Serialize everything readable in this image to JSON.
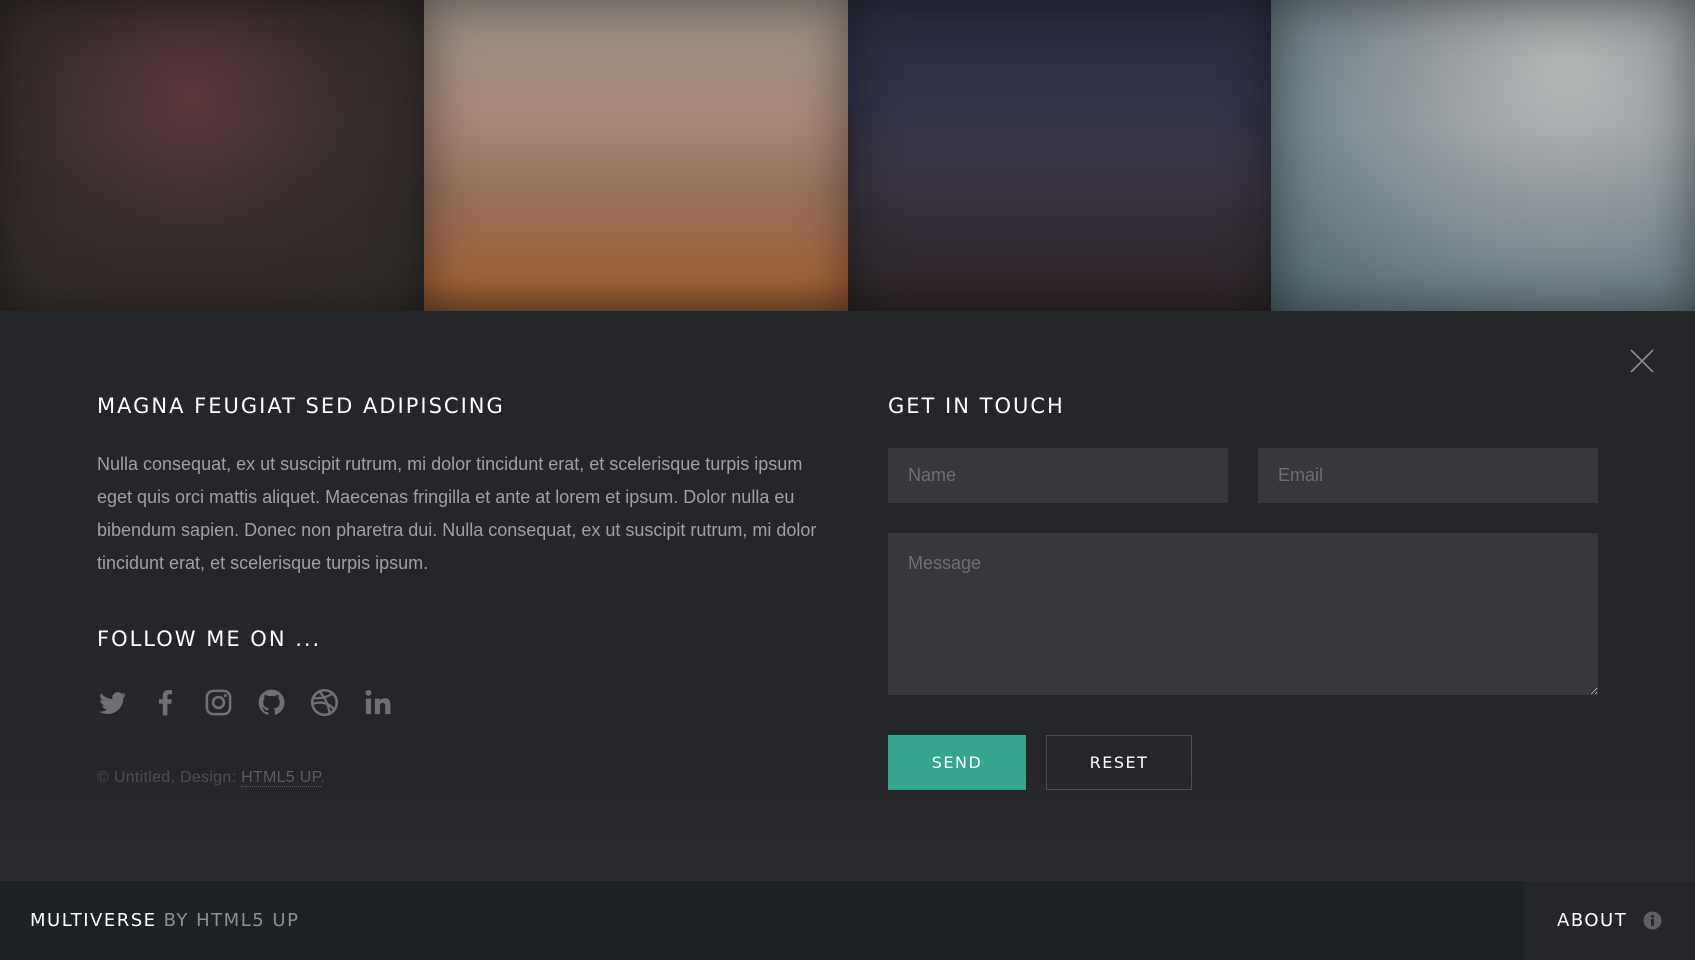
{
  "gallery": {
    "thumbnails": [
      "thumb-1",
      "thumb-2",
      "thumb-3",
      "thumb-4"
    ]
  },
  "panel": {
    "close_icon": "close-icon",
    "about": {
      "heading": "MAGNA FEUGIAT SED ADIPISCING",
      "text": "Nulla consequat, ex ut suscipit rutrum, mi dolor tincidunt erat, et scelerisque turpis ipsum eget quis orci mattis aliquet. Maecenas fringilla et ante at lorem et ipsum. Dolor nulla eu bibendum sapien. Donec non pharetra dui. Nulla consequat, ex ut suscipit rutrum, mi dolor tincidunt erat, et scelerisque turpis ipsum."
    },
    "follow": {
      "heading": "FOLLOW ME ON ...",
      "icons": [
        "twitter-icon",
        "facebook-icon",
        "instagram-icon",
        "github-icon",
        "dribbble-icon",
        "linkedin-icon"
      ]
    },
    "copyright": {
      "prefix": "© Untitled. Design: ",
      "link_label": "HTML5 UP",
      "suffix": "."
    },
    "contact": {
      "heading": "GET IN TOUCH",
      "name_placeholder": "Name",
      "email_placeholder": "Email",
      "message_placeholder": "Message",
      "send_label": "SEND",
      "reset_label": "RESET"
    }
  },
  "footer": {
    "brand_name": "MULTIVERSE",
    "brand_by": "BY HTML5 UP",
    "about_label": "ABOUT",
    "about_icon": "info-icon"
  },
  "colors": {
    "accent": "#34a58e",
    "panel_bg": "#242629",
    "footer_bg": "#1f2224",
    "field_bg": "#36383c"
  }
}
